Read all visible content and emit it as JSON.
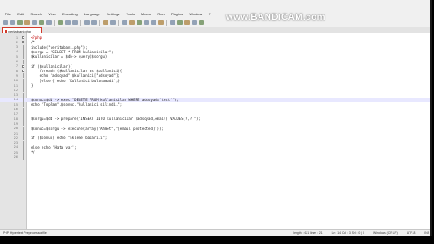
{
  "menu": [
    "File",
    "Edit",
    "Search",
    "View",
    "Encoding",
    "Language",
    "Settings",
    "Tools",
    "Macro",
    "Run",
    "Plugins",
    "Window",
    "?"
  ],
  "watermark": "www.BANDICAM.com",
  "tab": {
    "label": "veritabani.php"
  },
  "code_lines": [
    {
      "num": "1",
      "text": "<?php",
      "php": true,
      "fold": "box"
    },
    {
      "num": "2",
      "text": "/*",
      "fold": "box"
    },
    {
      "num": "3",
      "text": "include(\"veritabani.php\");",
      "fold": "line"
    },
    {
      "num": "4",
      "text": "$sorgu = \"SELECT * FROM kullanicilar\";",
      "fold": "line"
    },
    {
      "num": "5",
      "text": "$kullanicilar = $db-> query($sorgu);",
      "fold": "line"
    },
    {
      "num": "6",
      "text": "",
      "fold": "line"
    },
    {
      "num": "7",
      "text": "if ($kullanicilar){",
      "fold": "box"
    },
    {
      "num": "8",
      "text": "    foreach ($kullanicilar as $kullanici){",
      "fold": "box"
    },
    {
      "num": "9",
      "text": "    echo \"adsoyad\".$kullanici[\"adsoyad\"];",
      "fold": "line"
    },
    {
      "num": "10",
      "text": "    }else { echo 'Kullanici bulunamadi';}",
      "fold": "line"
    },
    {
      "num": "11",
      "text": "}",
      "fold": "line"
    },
    {
      "num": "12",
      "text": "",
      "fold": "line"
    },
    {
      "num": "13",
      "text": "",
      "fold": "line"
    },
    {
      "num": "14",
      "text": "$sonuc=$db -> exec(\"DELETE FROM kullanicilar WHERE adsoyad='test'\");",
      "fold": "line",
      "current": true
    },
    {
      "num": "15",
      "text": "echo \"Toplam\".$sonuc.\"kullanici silindi.\";",
      "fold": "line"
    },
    {
      "num": "16",
      "text": "",
      "fold": "line"
    },
    {
      "num": "17",
      "text": "",
      "fold": "line"
    },
    {
      "num": "18",
      "text": "$sorgu=$db -> prepare(\"INSERT INTO kullanicilar (adsoyad,email) VALUES(?,?)\");",
      "fold": "line"
    },
    {
      "num": "19",
      "text": "",
      "fold": "line"
    },
    {
      "num": "20",
      "text": "$sonuc=$sorgu -> execute(array(\"Ahmet\",\"[email protected]\"));",
      "fold": "line"
    },
    {
      "num": "21",
      "text": "",
      "fold": "line"
    },
    {
      "num": "22",
      "text": "if ($sonuc) echo \"Ekleme basarili\";",
      "fold": "line"
    },
    {
      "num": "23",
      "text": "",
      "fold": "line"
    },
    {
      "num": "24",
      "text": "else echo 'Hata var';",
      "fold": "line"
    },
    {
      "num": "25",
      "text": "*/",
      "fold": "line"
    },
    {
      "num": "26",
      "text": "",
      "fold": "line"
    }
  ],
  "status": {
    "file_type": "PHP Hypertext Preprocessor file",
    "length": "length : 621   lines : 21",
    "position": "Ln : 14   Col : 3   Sel : 0 | 0",
    "eol": "Windows (CR LF)",
    "encoding": "UTF-8",
    "mode": "INS"
  }
}
